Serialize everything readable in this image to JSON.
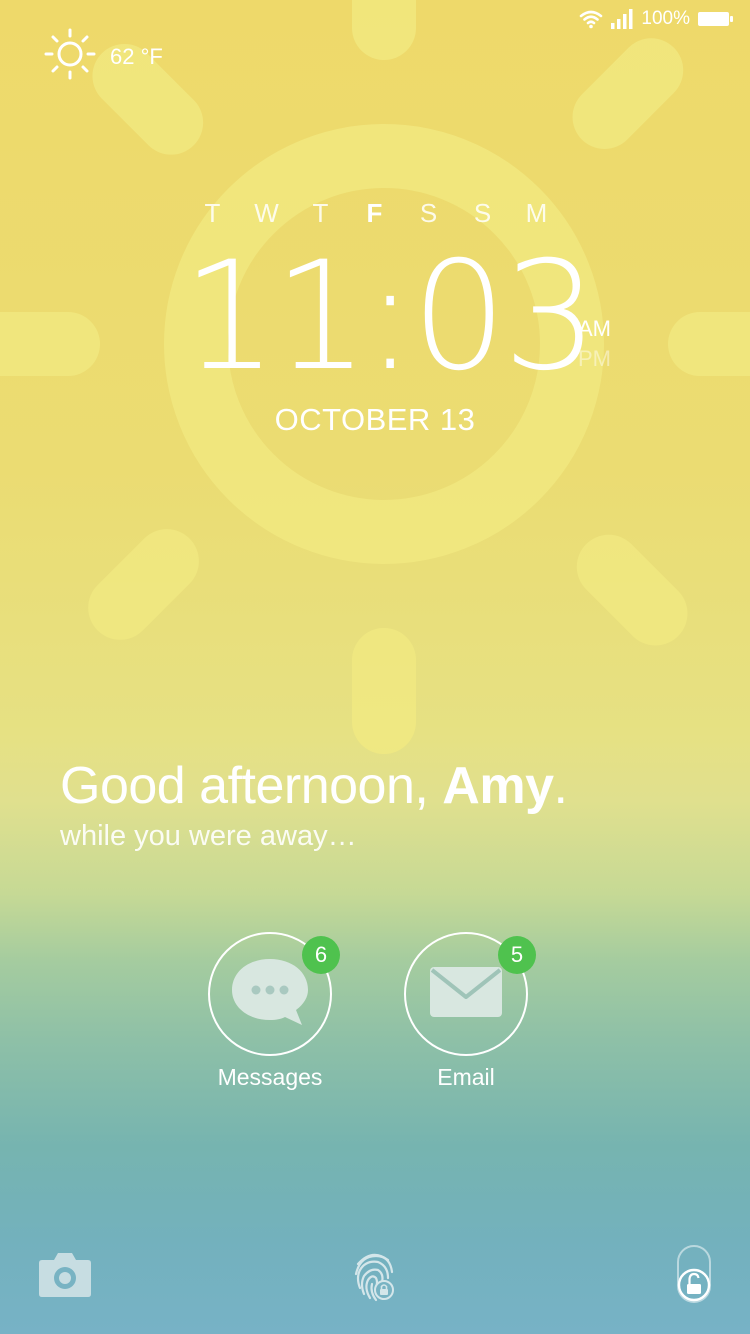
{
  "status_bar": {
    "battery_text": "100%"
  },
  "weather": {
    "temperature": "62 °F",
    "icon": "sun-icon"
  },
  "days": [
    "T",
    "W",
    "T",
    "F",
    "S",
    "S",
    "M"
  ],
  "active_day_index": 3,
  "clock": {
    "time": "11:03",
    "am": "AM",
    "pm": "PM"
  },
  "date": "OCTOBER 13",
  "greeting": {
    "prefix": "Good afternoon, ",
    "name": "Amy",
    "suffix": ".",
    "subtitle": "while you were away…"
  },
  "notifications": [
    {
      "label": "Messages",
      "count": "6",
      "icon": "chat-bubble-icon"
    },
    {
      "label": "Email",
      "count": "5",
      "icon": "envelope-icon"
    }
  ],
  "bottom_bar": {
    "left_icon": "camera-icon",
    "center_icon": "fingerprint-lock-icon",
    "right_icon": "unlock-icon"
  },
  "colors": {
    "badge": "#4fc24e",
    "sun_shape": "#f1e87e",
    "icon_fill": "#d8e7e0"
  }
}
